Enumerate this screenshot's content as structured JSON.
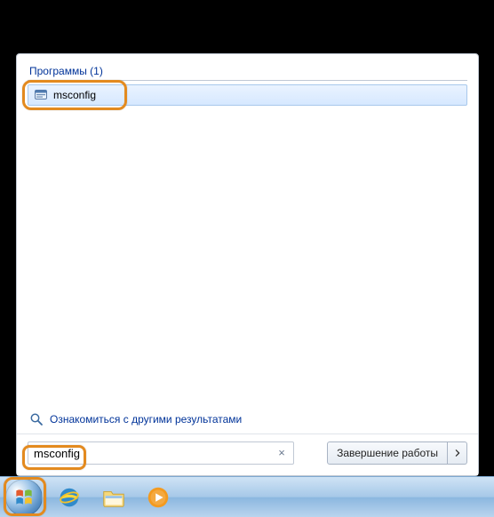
{
  "section": {
    "title": "Программы",
    "count": 1
  },
  "results": [
    {
      "label": "msconfig",
      "icon": "msconfig-icon"
    }
  ],
  "more_results": {
    "label": "Ознакомиться с другими результатами"
  },
  "search": {
    "value": "msconfig",
    "clear_symbol": "×"
  },
  "shutdown": {
    "label": "Завершение работы"
  },
  "annotation": {
    "highlight_result": true,
    "highlight_search": true,
    "highlight_start": true
  }
}
